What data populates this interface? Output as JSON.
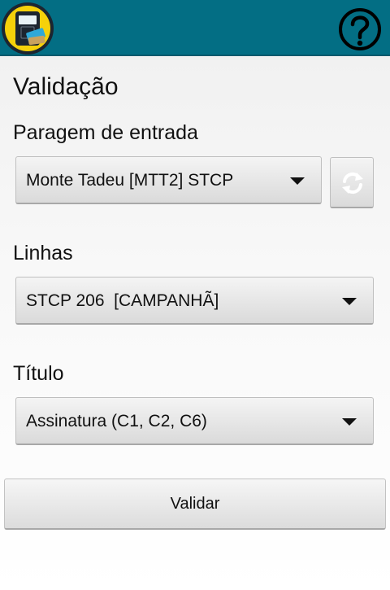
{
  "app_bar": {
    "logo_icon": "ticket-validator-app-icon",
    "help_icon": "help-circle-icon",
    "color": "#036e84"
  },
  "page": {
    "title": "Validação"
  },
  "entry_stop": {
    "label": "Paragem de entrada",
    "selected": "Monte Tadeu [MTT2] STCP",
    "refresh_icon": "refresh-icon"
  },
  "lines": {
    "label": "Linhas",
    "selected": "STCP 206  [CAMPANHÃ]"
  },
  "ticket": {
    "label": "Título",
    "selected": "Assinatura (C1, C2, C6)"
  },
  "validate_button": {
    "label": "Validar"
  }
}
